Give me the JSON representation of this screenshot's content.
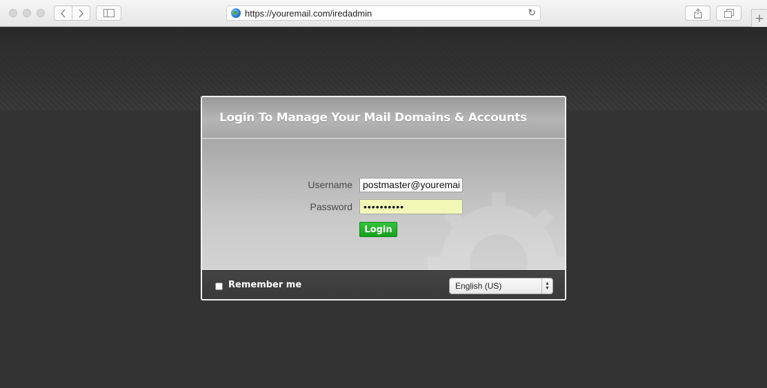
{
  "browser": {
    "url": "https://youremail.com/iredadmin",
    "back_icon": "chevron-left-icon",
    "forward_icon": "chevron-right-icon",
    "new_tab_label": "+"
  },
  "login": {
    "title": "Login To Manage Your Mail Domains & Accounts",
    "username_label": "Username",
    "username_value": "postmaster@youremai",
    "password_label": "Password",
    "password_value": "••••••••••",
    "login_button": "Login",
    "remember_label": "Remember me",
    "language_selected": "English (US)"
  },
  "colors": {
    "login_button": "#1ca825",
    "password_bg": "#f3f7b7",
    "page_bg": "#333333"
  }
}
